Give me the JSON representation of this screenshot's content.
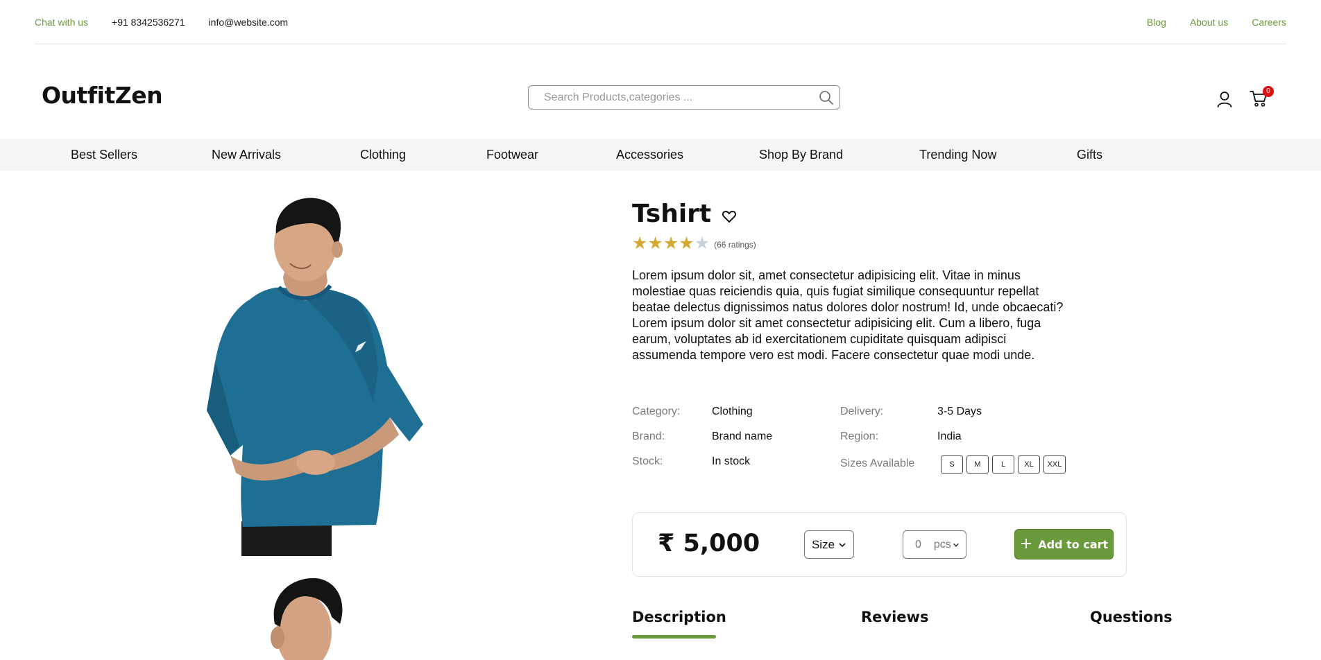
{
  "topbar": {
    "chat": "Chat with us",
    "phone": "+91 8342536271",
    "email": "info@website.com",
    "links": [
      "Blog",
      "About us",
      "Careers"
    ]
  },
  "header": {
    "logo": "OutfitZen",
    "search_placeholder": "Search Products,categories ...",
    "cart_count": "0"
  },
  "nav": [
    "Best Sellers",
    "New Arrivals",
    "Clothing",
    "Footwear",
    "Accessories",
    "Shop By Brand",
    "Trending Now",
    "Gifts"
  ],
  "product": {
    "title": "Tshirt",
    "rating": 4,
    "rating_max": 5,
    "ratings_text": "(66 ratings)",
    "description": "Lorem ipsum dolor sit, amet consectetur adipisicing elit. Vitae in minus molestiae quas reiciendis quia, quis fugiat similique consequuntur repellat beatae delectus dignissimos natus dolores dolor nostrum! Id, unde obcaecati? Lorem ipsum dolor sit amet consectetur adipisicing elit. Cum a libero, fuga earum, voluptates ab id exercitationem cupiditate quisquam adipisci assumenda tempore vero est modi. Facere consectetur quae modi unde.",
    "specs": {
      "category_label": "Category:",
      "category": "Clothing",
      "brand_label": "Brand:",
      "brand": "Brand name",
      "stock_label": "Stock:",
      "stock": "In stock",
      "delivery_label": "Delivery:",
      "delivery": "3-5 Days",
      "region_label": "Region:",
      "region": "India",
      "sizes_label": "Sizes Available"
    },
    "sizes": [
      "S",
      "M",
      "L",
      "XL",
      "XXL"
    ],
    "price": "₹ 5,000",
    "size_select": "Size",
    "qty_value": "0",
    "qty_unit": "pcs",
    "add_to_cart": "Add to cart"
  },
  "tabs": [
    "Description",
    "Reviews",
    "Questions"
  ],
  "colors": {
    "accent": "#6b9a3c",
    "badge": "#e01010",
    "star": "#d4a933",
    "shirt": "#1e6f93"
  }
}
